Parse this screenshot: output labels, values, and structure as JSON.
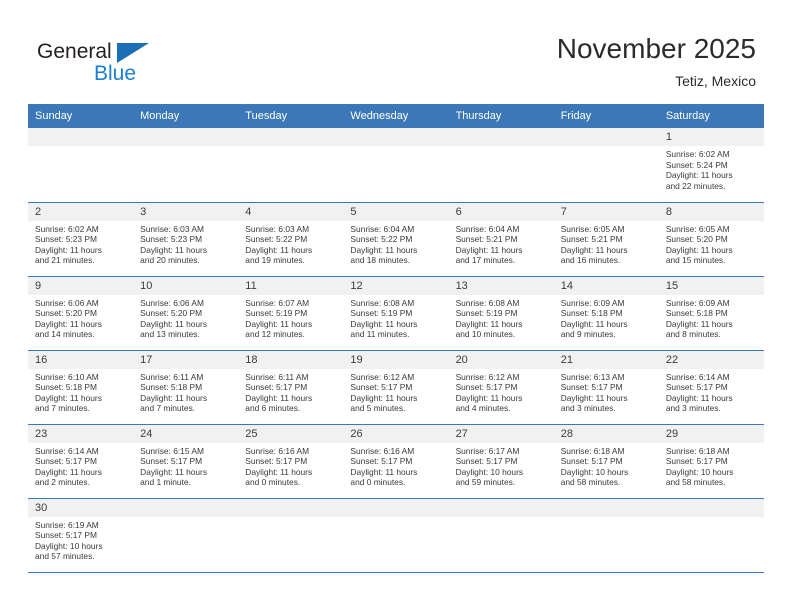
{
  "logo": {
    "word_top": "General",
    "word_bottom": "Blue",
    "accent_color": "#1b6fb5",
    "blue_text_color": "#1b7fd4"
  },
  "header": {
    "title": "November 2025",
    "location": "Tetiz, Mexico",
    "header_bg_color": "#3c78b8",
    "daynum_bg_color": "#f1f1f1"
  },
  "weekday_headers": [
    "Sunday",
    "Monday",
    "Tuesday",
    "Wednesday",
    "Thursday",
    "Friday",
    "Saturday"
  ],
  "weeks": [
    [
      {
        "empty": true
      },
      {
        "empty": true
      },
      {
        "empty": true
      },
      {
        "empty": true
      },
      {
        "empty": true
      },
      {
        "empty": true
      },
      {
        "day": "1",
        "sunrise": "Sunrise: 6:02 AM",
        "sunset": "Sunset: 5:24 PM",
        "daylight1": "Daylight: 11 hours",
        "daylight2": "and 22 minutes."
      }
    ],
    [
      {
        "day": "2",
        "sunrise": "Sunrise: 6:02 AM",
        "sunset": "Sunset: 5:23 PM",
        "daylight1": "Daylight: 11 hours",
        "daylight2": "and 21 minutes."
      },
      {
        "day": "3",
        "sunrise": "Sunrise: 6:03 AM",
        "sunset": "Sunset: 5:23 PM",
        "daylight1": "Daylight: 11 hours",
        "daylight2": "and 20 minutes."
      },
      {
        "day": "4",
        "sunrise": "Sunrise: 6:03 AM",
        "sunset": "Sunset: 5:22 PM",
        "daylight1": "Daylight: 11 hours",
        "daylight2": "and 19 minutes."
      },
      {
        "day": "5",
        "sunrise": "Sunrise: 6:04 AM",
        "sunset": "Sunset: 5:22 PM",
        "daylight1": "Daylight: 11 hours",
        "daylight2": "and 18 minutes."
      },
      {
        "day": "6",
        "sunrise": "Sunrise: 6:04 AM",
        "sunset": "Sunset: 5:21 PM",
        "daylight1": "Daylight: 11 hours",
        "daylight2": "and 17 minutes."
      },
      {
        "day": "7",
        "sunrise": "Sunrise: 6:05 AM",
        "sunset": "Sunset: 5:21 PM",
        "daylight1": "Daylight: 11 hours",
        "daylight2": "and 16 minutes."
      },
      {
        "day": "8",
        "sunrise": "Sunrise: 6:05 AM",
        "sunset": "Sunset: 5:20 PM",
        "daylight1": "Daylight: 11 hours",
        "daylight2": "and 15 minutes."
      }
    ],
    [
      {
        "day": "9",
        "sunrise": "Sunrise: 6:06 AM",
        "sunset": "Sunset: 5:20 PM",
        "daylight1": "Daylight: 11 hours",
        "daylight2": "and 14 minutes."
      },
      {
        "day": "10",
        "sunrise": "Sunrise: 6:06 AM",
        "sunset": "Sunset: 5:20 PM",
        "daylight1": "Daylight: 11 hours",
        "daylight2": "and 13 minutes."
      },
      {
        "day": "11",
        "sunrise": "Sunrise: 6:07 AM",
        "sunset": "Sunset: 5:19 PM",
        "daylight1": "Daylight: 11 hours",
        "daylight2": "and 12 minutes."
      },
      {
        "day": "12",
        "sunrise": "Sunrise: 6:08 AM",
        "sunset": "Sunset: 5:19 PM",
        "daylight1": "Daylight: 11 hours",
        "daylight2": "and 11 minutes."
      },
      {
        "day": "13",
        "sunrise": "Sunrise: 6:08 AM",
        "sunset": "Sunset: 5:19 PM",
        "daylight1": "Daylight: 11 hours",
        "daylight2": "and 10 minutes."
      },
      {
        "day": "14",
        "sunrise": "Sunrise: 6:09 AM",
        "sunset": "Sunset: 5:18 PM",
        "daylight1": "Daylight: 11 hours",
        "daylight2": "and 9 minutes."
      },
      {
        "day": "15",
        "sunrise": "Sunrise: 6:09 AM",
        "sunset": "Sunset: 5:18 PM",
        "daylight1": "Daylight: 11 hours",
        "daylight2": "and 8 minutes."
      }
    ],
    [
      {
        "day": "16",
        "sunrise": "Sunrise: 6:10 AM",
        "sunset": "Sunset: 5:18 PM",
        "daylight1": "Daylight: 11 hours",
        "daylight2": "and 7 minutes."
      },
      {
        "day": "17",
        "sunrise": "Sunrise: 6:11 AM",
        "sunset": "Sunset: 5:18 PM",
        "daylight1": "Daylight: 11 hours",
        "daylight2": "and 7 minutes."
      },
      {
        "day": "18",
        "sunrise": "Sunrise: 6:11 AM",
        "sunset": "Sunset: 5:17 PM",
        "daylight1": "Daylight: 11 hours",
        "daylight2": "and 6 minutes."
      },
      {
        "day": "19",
        "sunrise": "Sunrise: 6:12 AM",
        "sunset": "Sunset: 5:17 PM",
        "daylight1": "Daylight: 11 hours",
        "daylight2": "and 5 minutes."
      },
      {
        "day": "20",
        "sunrise": "Sunrise: 6:12 AM",
        "sunset": "Sunset: 5:17 PM",
        "daylight1": "Daylight: 11 hours",
        "daylight2": "and 4 minutes."
      },
      {
        "day": "21",
        "sunrise": "Sunrise: 6:13 AM",
        "sunset": "Sunset: 5:17 PM",
        "daylight1": "Daylight: 11 hours",
        "daylight2": "and 3 minutes."
      },
      {
        "day": "22",
        "sunrise": "Sunrise: 6:14 AM",
        "sunset": "Sunset: 5:17 PM",
        "daylight1": "Daylight: 11 hours",
        "daylight2": "and 3 minutes."
      }
    ],
    [
      {
        "day": "23",
        "sunrise": "Sunrise: 6:14 AM",
        "sunset": "Sunset: 5:17 PM",
        "daylight1": "Daylight: 11 hours",
        "daylight2": "and 2 minutes."
      },
      {
        "day": "24",
        "sunrise": "Sunrise: 6:15 AM",
        "sunset": "Sunset: 5:17 PM",
        "daylight1": "Daylight: 11 hours",
        "daylight2": "and 1 minute."
      },
      {
        "day": "25",
        "sunrise": "Sunrise: 6:16 AM",
        "sunset": "Sunset: 5:17 PM",
        "daylight1": "Daylight: 11 hours",
        "daylight2": "and 0 minutes."
      },
      {
        "day": "26",
        "sunrise": "Sunrise: 6:16 AM",
        "sunset": "Sunset: 5:17 PM",
        "daylight1": "Daylight: 11 hours",
        "daylight2": "and 0 minutes."
      },
      {
        "day": "27",
        "sunrise": "Sunrise: 6:17 AM",
        "sunset": "Sunset: 5:17 PM",
        "daylight1": "Daylight: 10 hours",
        "daylight2": "and 59 minutes."
      },
      {
        "day": "28",
        "sunrise": "Sunrise: 6:18 AM",
        "sunset": "Sunset: 5:17 PM",
        "daylight1": "Daylight: 10 hours",
        "daylight2": "and 58 minutes."
      },
      {
        "day": "29",
        "sunrise": "Sunrise: 6:18 AM",
        "sunset": "Sunset: 5:17 PM",
        "daylight1": "Daylight: 10 hours",
        "daylight2": "and 58 minutes."
      }
    ],
    [
      {
        "day": "30",
        "sunrise": "Sunrise: 6:19 AM",
        "sunset": "Sunset: 5:17 PM",
        "daylight1": "Daylight: 10 hours",
        "daylight2": "and 57 minutes."
      },
      {
        "empty": true
      },
      {
        "empty": true
      },
      {
        "empty": true
      },
      {
        "empty": true
      },
      {
        "empty": true
      },
      {
        "empty": true
      }
    ]
  ]
}
